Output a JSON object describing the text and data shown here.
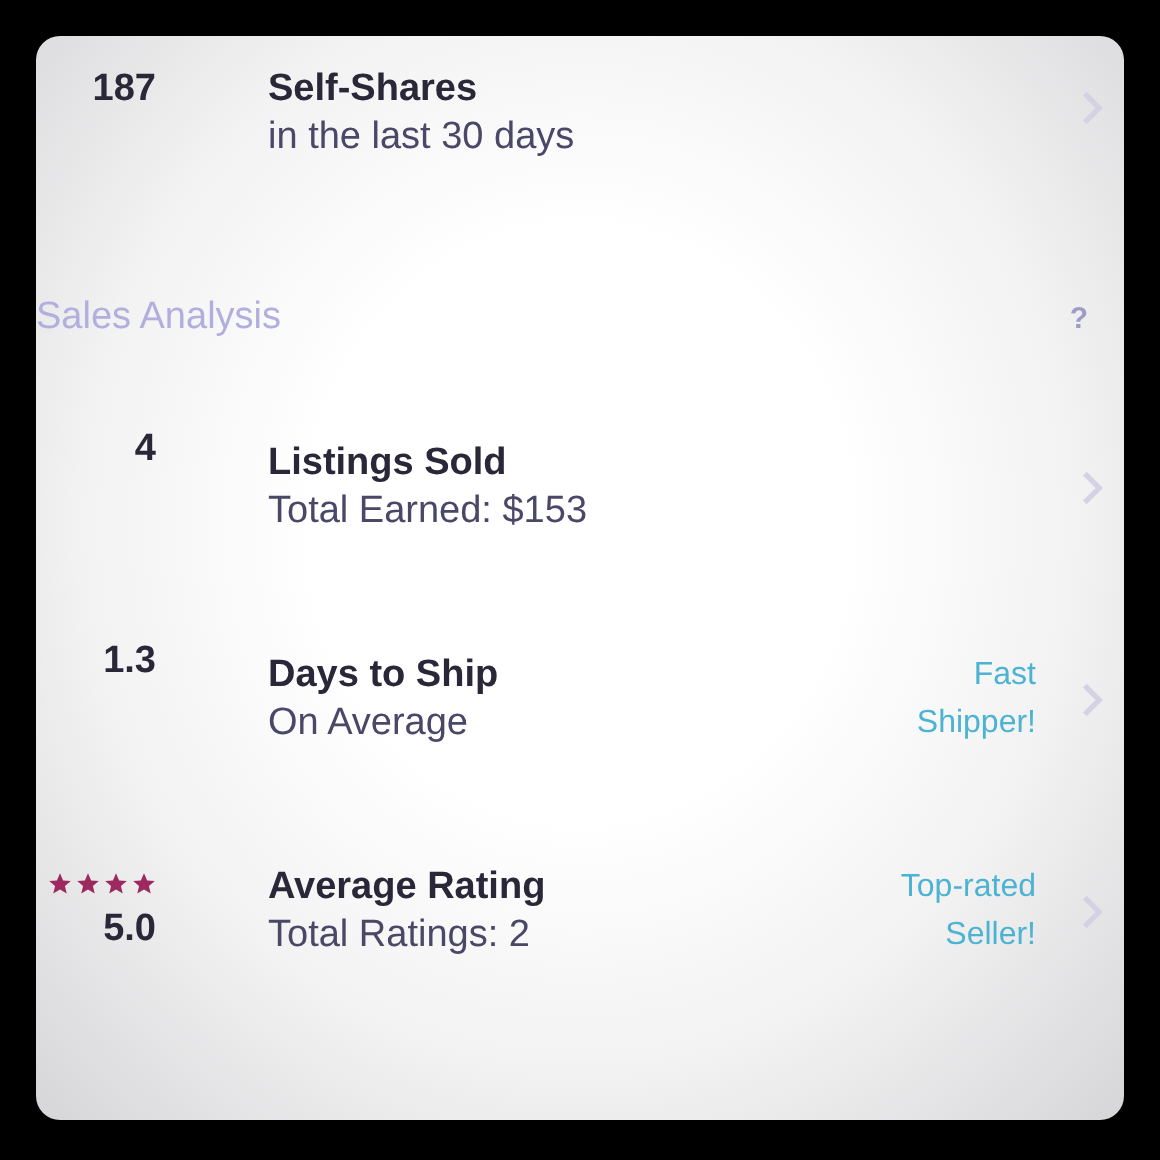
{
  "top_row": {
    "value": "187",
    "title": "Self-Shares",
    "subtitle": "in the last 30 days"
  },
  "section": {
    "title": "Sales Analysis",
    "help": "?"
  },
  "rows": [
    {
      "kind": "plain",
      "value": "4",
      "title": "Listings Sold",
      "subtitle": "Total Earned: $153"
    },
    {
      "kind": "badge",
      "value": "1.3",
      "title": "Days to Ship",
      "subtitle": "On Average",
      "badge": [
        "Fast",
        "Shipper!"
      ]
    },
    {
      "kind": "rating",
      "value": "5.0",
      "stars": 4,
      "title": "Average Rating",
      "subtitle": "Total Ratings: 2",
      "badge": [
        "Top-rated",
        "Seller!"
      ]
    }
  ]
}
